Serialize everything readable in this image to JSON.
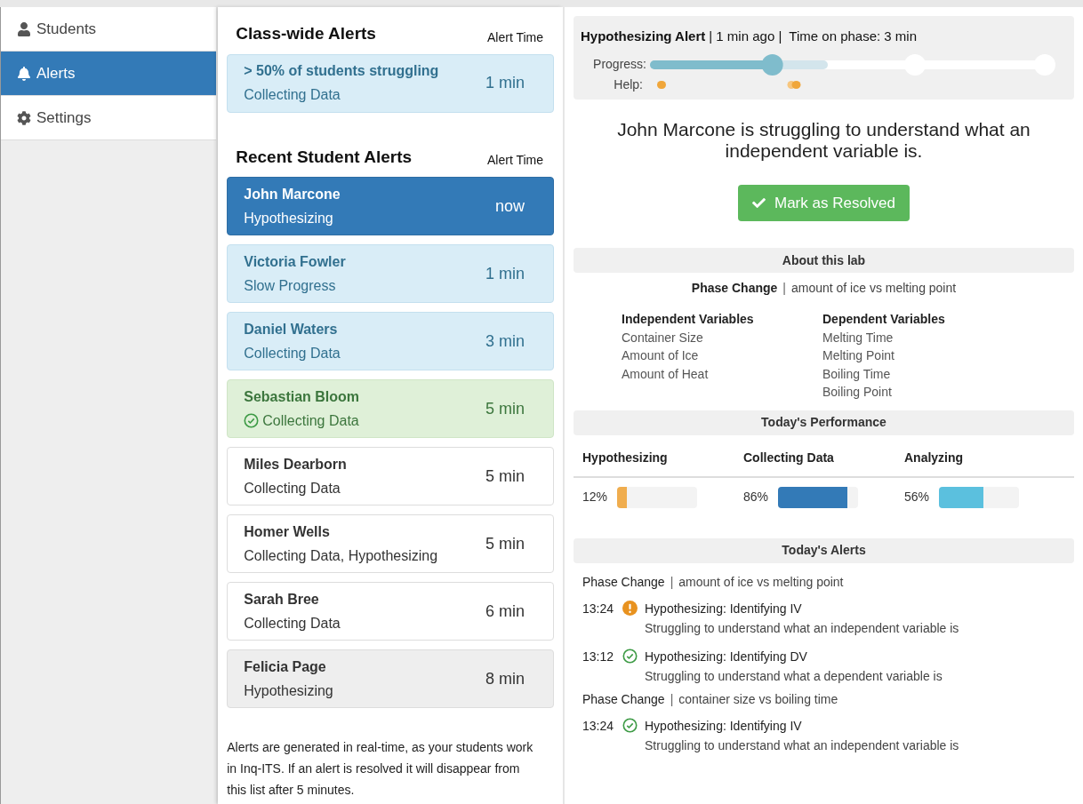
{
  "sidebar": {
    "items": [
      {
        "label": "Students",
        "selected": false
      },
      {
        "label": "Alerts",
        "selected": true
      },
      {
        "label": "Settings",
        "selected": false
      }
    ]
  },
  "class_alerts": {
    "title": "Class-wide Alerts",
    "time_header": "Alert Time",
    "items": [
      {
        "title": "> 50% of students struggling",
        "subtitle": "Collecting Data",
        "time": "1 min",
        "kind": "info",
        "resolved": false
      }
    ]
  },
  "student_alerts": {
    "title": "Recent Student Alerts",
    "time_header": "Alert Time",
    "items": [
      {
        "title": "John Marcone",
        "subtitle": "Hypothesizing",
        "time": "now",
        "kind": "selected",
        "resolved": false
      },
      {
        "title": "Victoria Fowler",
        "subtitle": "Slow Progress",
        "time": "1 min",
        "kind": "info",
        "resolved": false
      },
      {
        "title": "Daniel Waters",
        "subtitle": "Collecting Data",
        "time": "3 min",
        "kind": "info",
        "resolved": false
      },
      {
        "title": "Sebastian Bloom",
        "subtitle": "Collecting Data",
        "time": "5 min",
        "kind": "success",
        "resolved": true
      },
      {
        "title": "Miles Dearborn",
        "subtitle": "Collecting Data",
        "time": "5 min",
        "kind": "default",
        "resolved": false
      },
      {
        "title": "Homer Wells",
        "subtitle": "Collecting Data, Hypothesizing",
        "time": "5 min",
        "kind": "default",
        "resolved": false
      },
      {
        "title": "Sarah Bree",
        "subtitle": "Collecting Data",
        "time": "6 min",
        "kind": "default",
        "resolved": false
      },
      {
        "title": "Felicia Page",
        "subtitle": "Hypothesizing",
        "time": "8 min",
        "kind": "muted",
        "resolved": false
      }
    ]
  },
  "footnote": "Alerts are generated in real-time, as your students work in Inq-ITS. If an alert is resolved it will disappear from this list after 5 minutes.",
  "detail": {
    "alert_title": "Hypothesizing Alert",
    "alert_info": "| 1 min ago |  Time on phase: 3 min",
    "progress_label": "Progress:",
    "progress": {
      "level": 0.31
    },
    "help_label": "Help:",
    "message": "John Marcone is struggling to understand what an independent variable is.",
    "resolve_button": "Mark as Resolved"
  },
  "about": {
    "title": "About this lab",
    "lab_name": "Phase Change",
    "separator": "|",
    "lab_desc": "amount of ice vs melting point",
    "columns": [
      {
        "heading": "Independent Variables",
        "items": [
          "Container Size",
          "Amount of Ice",
          "Amount of Heat"
        ]
      },
      {
        "heading": "Dependent Variables",
        "items": [
          "Melting Time",
          "Melting Point",
          "Boiling Time",
          "Boiling Point"
        ]
      }
    ]
  },
  "performance": {
    "title": "Today's Performance",
    "phases": [
      {
        "name": "Hypothesizing",
        "value": "12%",
        "level": 0.12,
        "color": "#f0ad4e"
      },
      {
        "name": "Collecting Data",
        "value": "86%",
        "level": 0.87,
        "color": "#337ab7"
      },
      {
        "name": "Analyzing",
        "value": "56%",
        "level": 0.56,
        "color": "#5bc0de"
      }
    ]
  },
  "todays_alerts": {
    "title": "Today's Alerts",
    "groups": [
      {
        "lab_name": "Phase Change",
        "separator": "|",
        "lab_desc": "amount of ice vs melting point",
        "items": [
          {
            "time": "13:24",
            "kind": "warning",
            "title": "Hypothesizing: Identifying IV",
            "detail": "Struggling to understand what an independent variable is"
          },
          {
            "time": "13:12",
            "kind": "resolved",
            "title": "Hypothesizing: Identifying DV",
            "detail": "Struggling to understand what a dependent variable is"
          }
        ]
      },
      {
        "lab_name": "Phase Change",
        "separator": "|",
        "lab_desc": "container size vs boiling time",
        "items": [
          {
            "time": "13:24",
            "kind": "resolved",
            "title": "Hypothesizing: Identifying IV",
            "detail": "Struggling to understand what an independent variable is"
          }
        ]
      }
    ]
  }
}
